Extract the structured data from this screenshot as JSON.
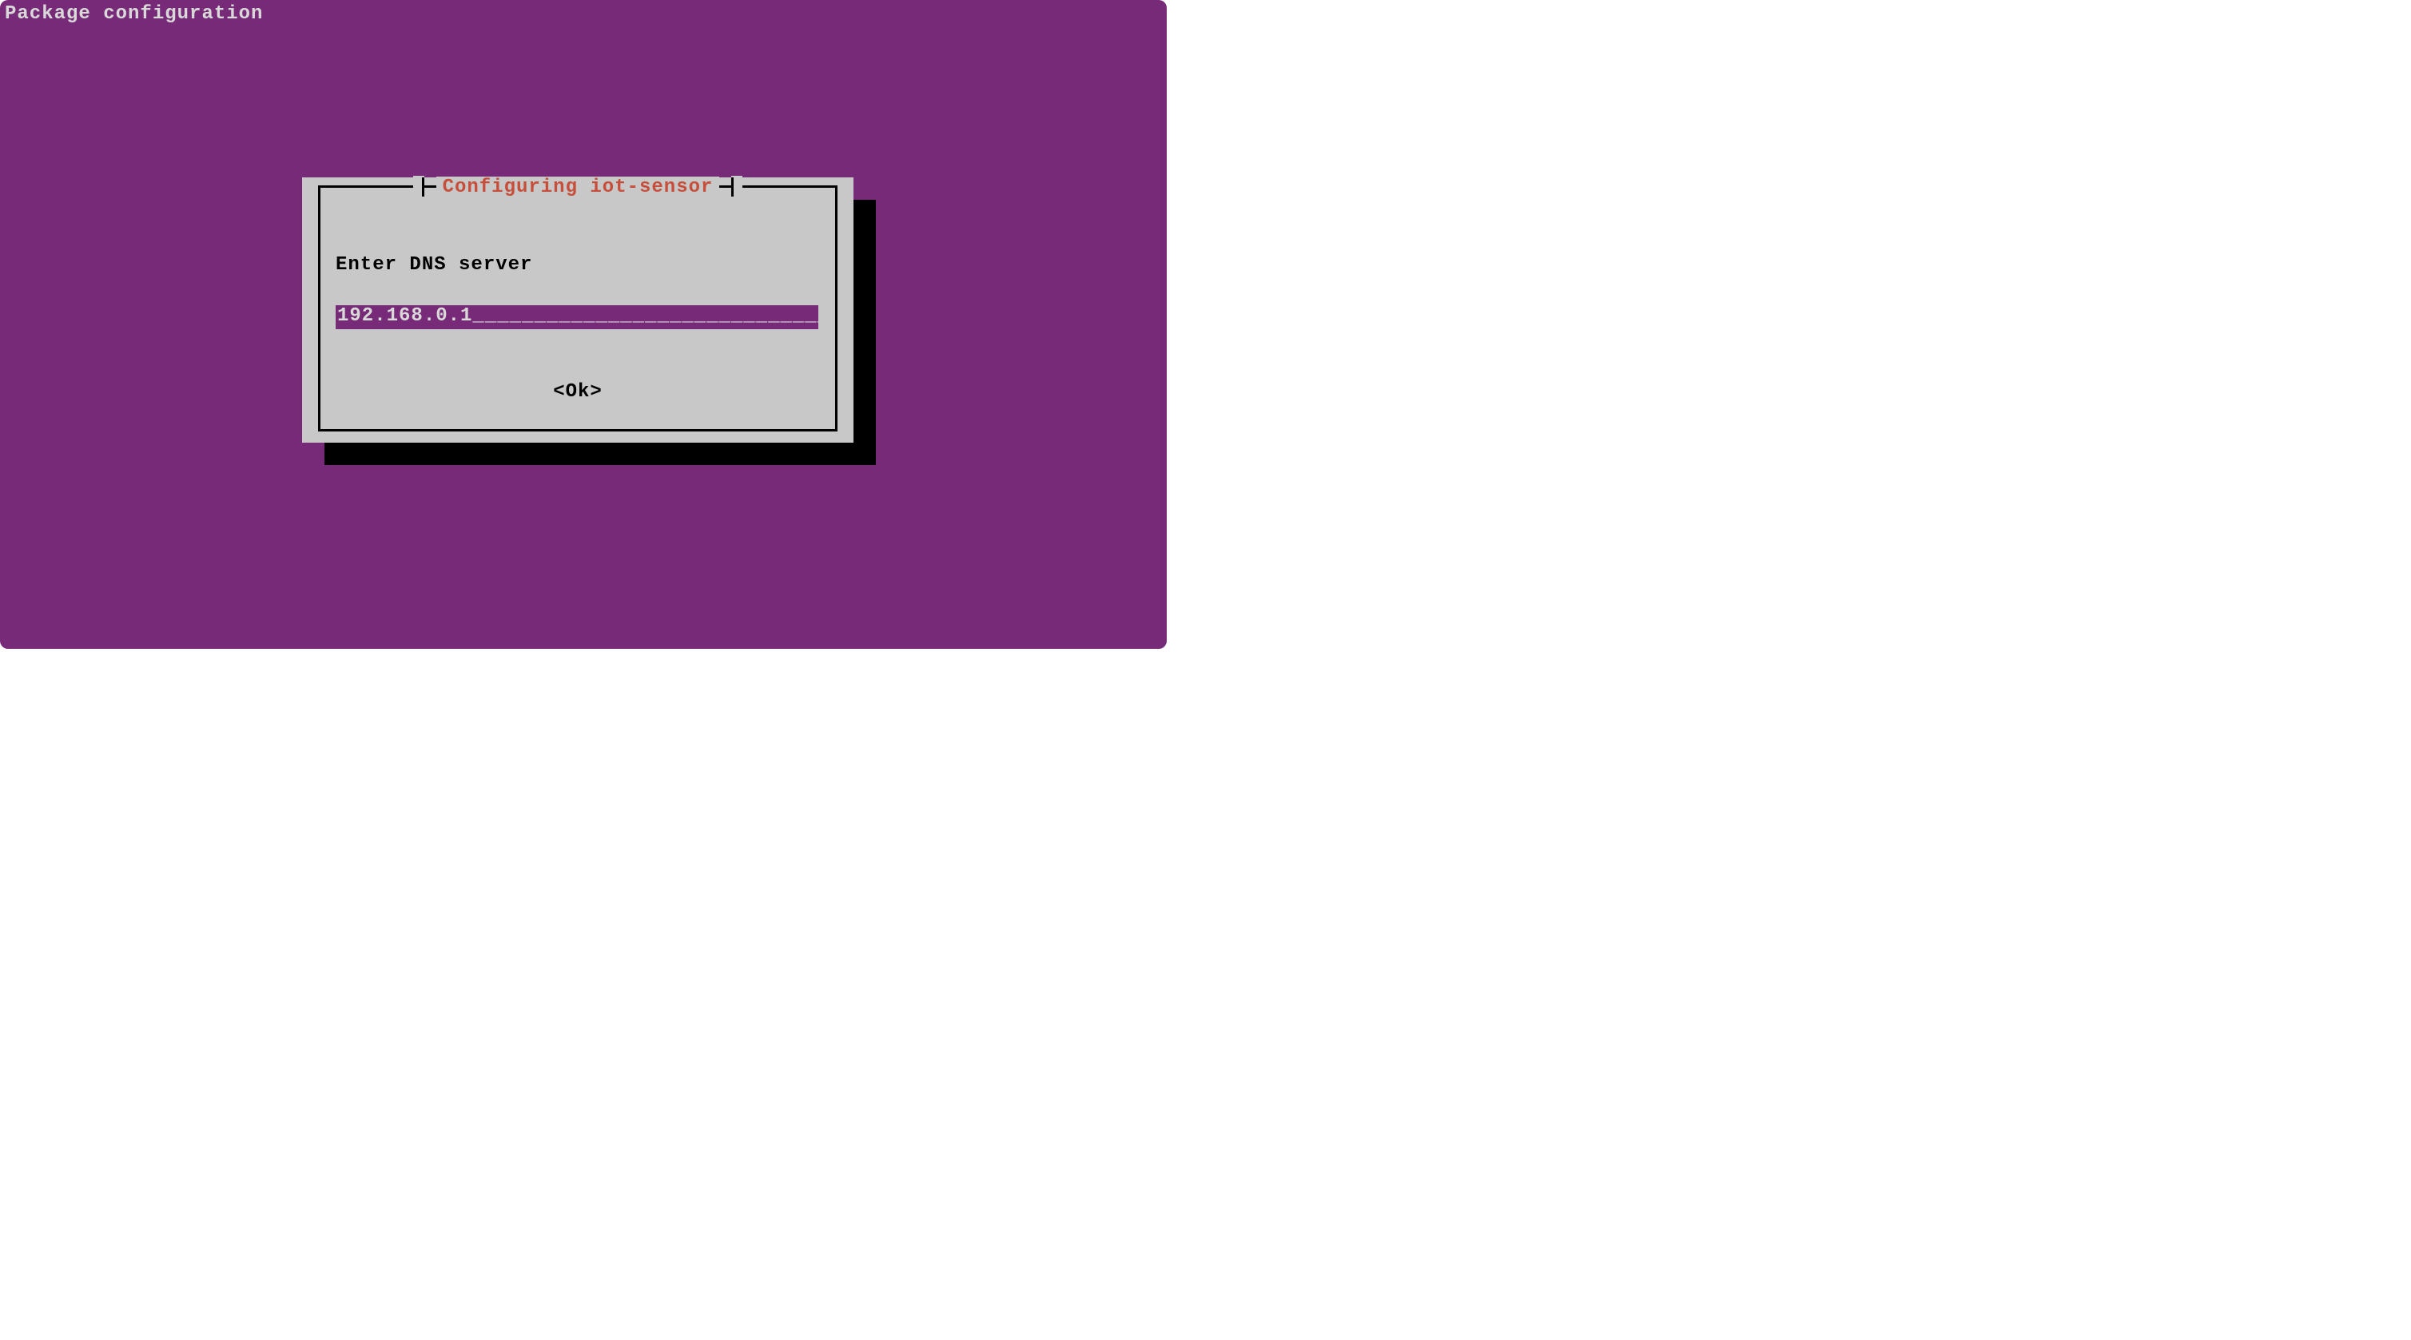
{
  "header": {
    "title": "Package configuration"
  },
  "dialog": {
    "title": "Configuring iot-sensor",
    "prompt": "Enter DNS server",
    "input_value": "192.168.0.1",
    "input_width_chars": 40,
    "ok_label": "<Ok>"
  },
  "colors": {
    "background": "#762a78",
    "panel": "#c8c8c8",
    "shadow": "#000000",
    "title_accent": "#c64e3a",
    "text_light": "#d9d9d9",
    "text_dark": "#000000"
  }
}
